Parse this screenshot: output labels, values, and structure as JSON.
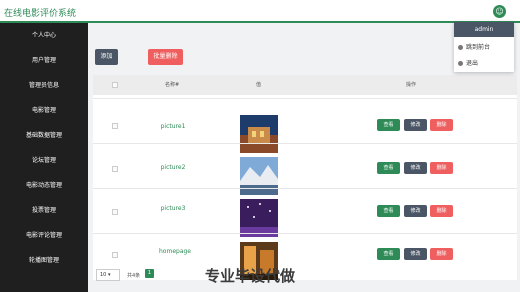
{
  "app_title": "在线电影评价系统",
  "user_menu": {
    "username": "admin",
    "items": [
      "跳到前台",
      "退出"
    ]
  },
  "sidebar": {
    "items": [
      "个人中心",
      "用户管理",
      "管理员信息",
      "电影管理",
      "基础数据管理",
      "论坛管理",
      "电影动态管理",
      "投票管理",
      "电影评论管理",
      "轮播图管理"
    ]
  },
  "toolbar": {
    "add_label": "添加",
    "bulk_delete_label": "批量删除"
  },
  "table": {
    "headers": {
      "name": "名称#",
      "image": "值",
      "actions": "操作"
    },
    "rows": [
      {
        "name": "picture1"
      },
      {
        "name": "picture2"
      },
      {
        "name": "picture3"
      },
      {
        "name": "homepage"
      }
    ],
    "actions": {
      "view": "查看",
      "edit": "修改",
      "delete": "删除"
    }
  },
  "pagination": {
    "page_size": "10",
    "total": "共4条",
    "current_page": "1"
  },
  "watermark": "专业毕设代做",
  "colors": {
    "accent": "#2e8b57",
    "sidebar_bg": "#1f1f1f",
    "danger": "#ef5f5f",
    "neutral_button": "#4a5665"
  }
}
